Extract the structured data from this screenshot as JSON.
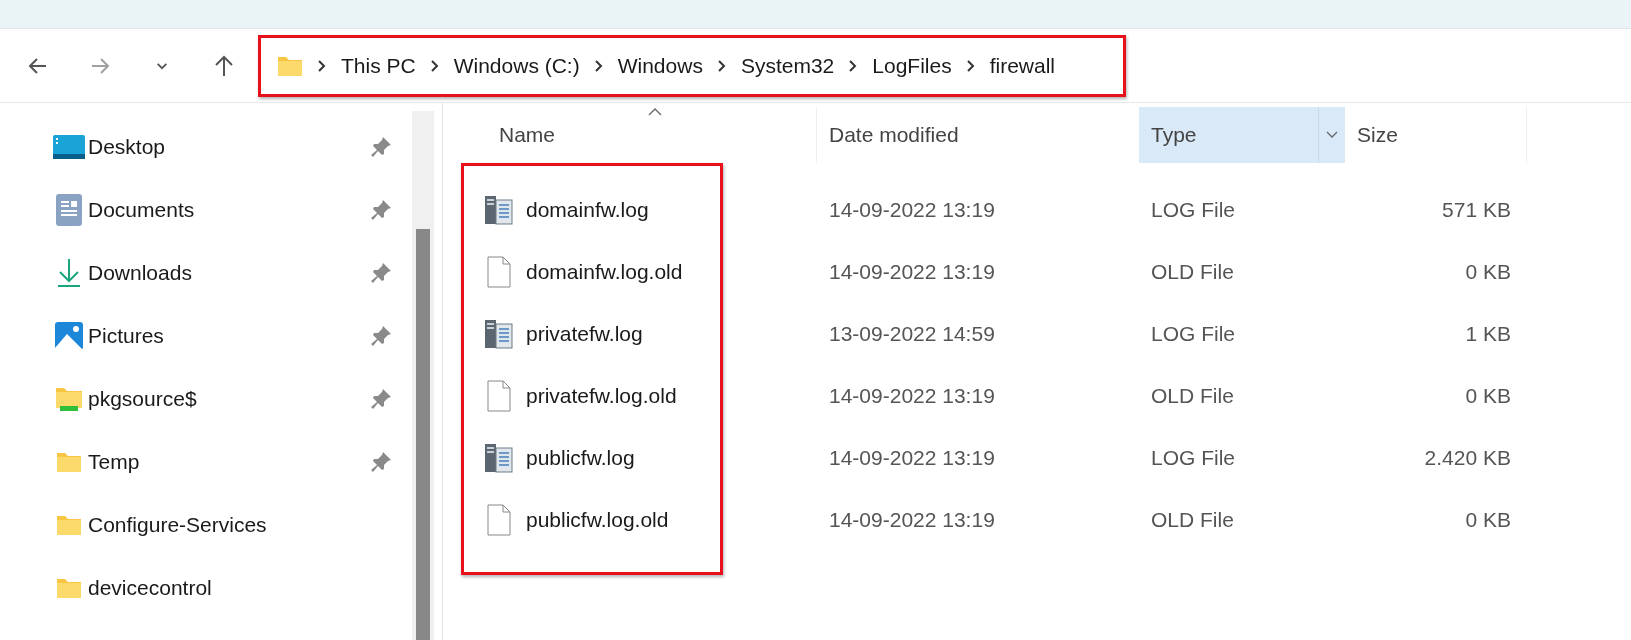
{
  "nav_buttons": [
    {
      "kind": "back",
      "disabled": false
    },
    {
      "kind": "forward",
      "disabled": true
    },
    {
      "kind": "recent",
      "disabled": false
    },
    {
      "kind": "up",
      "disabled": false
    }
  ],
  "address_bar": {
    "highlighted": true,
    "crumbs": [
      "This PC",
      "Windows (C:)",
      "Windows",
      "System32",
      "LogFiles",
      "firewall"
    ]
  },
  "sidebar": {
    "items": [
      {
        "label": "Desktop",
        "kind": "desktop",
        "pinned": true
      },
      {
        "label": "Documents",
        "kind": "documents",
        "pinned": true
      },
      {
        "label": "Downloads",
        "kind": "downloads",
        "pinned": true
      },
      {
        "label": "Pictures",
        "kind": "pictures",
        "pinned": true
      },
      {
        "label": "pkgsource$",
        "kind": "share",
        "pinned": true
      },
      {
        "label": "Temp",
        "kind": "folder",
        "pinned": true
      },
      {
        "label": "Configure-Services",
        "kind": "folder",
        "pinned": false
      },
      {
        "label": "devicecontrol",
        "kind": "folder",
        "pinned": false
      }
    ]
  },
  "table": {
    "names_highlighted": true,
    "columns": [
      {
        "label": "Name",
        "sorted": true,
        "hovered": false
      },
      {
        "label": "Date modified",
        "sorted": false,
        "hovered": false
      },
      {
        "label": "Type",
        "sorted": false,
        "hovered": true
      },
      {
        "label": "Size",
        "sorted": false,
        "hovered": false
      }
    ],
    "rows": [
      {
        "name": "domainfw.log",
        "kind": "log",
        "date": "14-09-2022 13:19",
        "type": "LOG File",
        "size": "571 KB"
      },
      {
        "name": "domainfw.log.old",
        "kind": "old",
        "date": "14-09-2022 13:19",
        "type": "OLD File",
        "size": "0 KB"
      },
      {
        "name": "privatefw.log",
        "kind": "log",
        "date": "13-09-2022 14:59",
        "type": "LOG File",
        "size": "1 KB"
      },
      {
        "name": "privatefw.log.old",
        "kind": "old",
        "date": "14-09-2022 13:19",
        "type": "OLD File",
        "size": "0 KB"
      },
      {
        "name": "publicfw.log",
        "kind": "log",
        "date": "14-09-2022 13:19",
        "type": "LOG File",
        "size": "2.420 KB"
      },
      {
        "name": "publicfw.log.old",
        "kind": "old",
        "date": "14-09-2022 13:19",
        "type": "OLD File",
        "size": "0 KB"
      }
    ]
  }
}
